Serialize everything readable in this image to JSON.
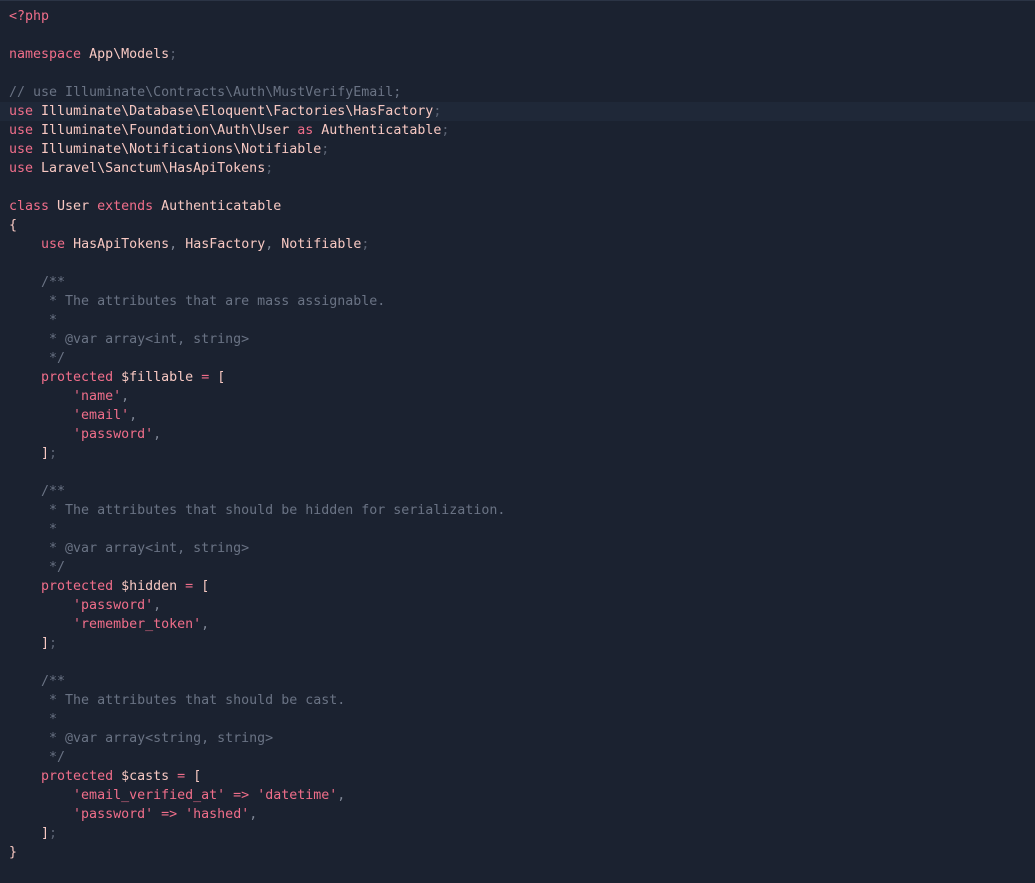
{
  "editor": {
    "language": "php",
    "current_line": 6,
    "colors": {
      "background": "#1b2230",
      "keyword": "#f06e8a",
      "identifier": "#f7c8c2",
      "comment": "#6a7384",
      "string": "#f06e8a",
      "punctuation": "#7f8796"
    }
  },
  "lines": [
    [
      [
        "tag",
        "<?php"
      ]
    ],
    [],
    [
      [
        "kw",
        "namespace"
      ],
      [
        "space",
        " "
      ],
      [
        "ns",
        "App\\Models"
      ],
      [
        "semi",
        ";"
      ]
    ],
    [],
    [
      [
        "comment",
        "// use Illuminate\\Contracts\\Auth\\MustVerifyEmail;"
      ]
    ],
    [
      [
        "kw",
        "use"
      ],
      [
        "space",
        " "
      ],
      [
        "ns",
        "Illuminate\\Database\\Eloquent\\Factories\\HasFactory"
      ],
      [
        "semi",
        ";"
      ]
    ],
    [
      [
        "kw",
        "use"
      ],
      [
        "space",
        " "
      ],
      [
        "ns",
        "Illuminate\\Foundation\\Auth\\User"
      ],
      [
        "space",
        " "
      ],
      [
        "kw",
        "as"
      ],
      [
        "space",
        " "
      ],
      [
        "id",
        "Authenticatable"
      ],
      [
        "semi",
        ";"
      ]
    ],
    [
      [
        "kw",
        "use"
      ],
      [
        "space",
        " "
      ],
      [
        "ns",
        "Illuminate\\Notifications\\Notifiable"
      ],
      [
        "semi",
        ";"
      ]
    ],
    [
      [
        "kw",
        "use"
      ],
      [
        "space",
        " "
      ],
      [
        "ns",
        "Laravel\\Sanctum\\HasApiTokens"
      ],
      [
        "semi",
        ";"
      ]
    ],
    [],
    [
      [
        "kw",
        "class"
      ],
      [
        "space",
        " "
      ],
      [
        "id",
        "User"
      ],
      [
        "space",
        " "
      ],
      [
        "kw",
        "extends"
      ],
      [
        "space",
        " "
      ],
      [
        "id",
        "Authenticatable"
      ]
    ],
    [
      [
        "brace",
        "{"
      ]
    ],
    [
      [
        "space",
        "    "
      ],
      [
        "kw",
        "use"
      ],
      [
        "space",
        " "
      ],
      [
        "id",
        "HasApiTokens"
      ],
      [
        "punc",
        ","
      ],
      [
        "space",
        " "
      ],
      [
        "id",
        "HasFactory"
      ],
      [
        "punc",
        ","
      ],
      [
        "space",
        " "
      ],
      [
        "id",
        "Notifiable"
      ],
      [
        "semi",
        ";"
      ]
    ],
    [],
    [
      [
        "space",
        "    "
      ],
      [
        "comment",
        "/**"
      ]
    ],
    [
      [
        "space",
        "    "
      ],
      [
        "comment",
        " * The attributes that are mass assignable."
      ]
    ],
    [
      [
        "space",
        "    "
      ],
      [
        "comment",
        " *"
      ]
    ],
    [
      [
        "space",
        "    "
      ],
      [
        "comment",
        " * @var array<int, string>"
      ]
    ],
    [
      [
        "space",
        "    "
      ],
      [
        "comment",
        " */"
      ]
    ],
    [
      [
        "space",
        "    "
      ],
      [
        "kw",
        "protected"
      ],
      [
        "space",
        " "
      ],
      [
        "var",
        "$fillable"
      ],
      [
        "space",
        " "
      ],
      [
        "op",
        "="
      ],
      [
        "space",
        " "
      ],
      [
        "brace",
        "["
      ]
    ],
    [
      [
        "space",
        "        "
      ],
      [
        "str",
        "'name'"
      ],
      [
        "punc",
        ","
      ]
    ],
    [
      [
        "space",
        "        "
      ],
      [
        "str",
        "'email'"
      ],
      [
        "punc",
        ","
      ]
    ],
    [
      [
        "space",
        "        "
      ],
      [
        "str",
        "'password'"
      ],
      [
        "punc",
        ","
      ]
    ],
    [
      [
        "space",
        "    "
      ],
      [
        "brace",
        "]"
      ],
      [
        "semi",
        ";"
      ]
    ],
    [],
    [
      [
        "space",
        "    "
      ],
      [
        "comment",
        "/**"
      ]
    ],
    [
      [
        "space",
        "    "
      ],
      [
        "comment",
        " * The attributes that should be hidden for serialization."
      ]
    ],
    [
      [
        "space",
        "    "
      ],
      [
        "comment",
        " *"
      ]
    ],
    [
      [
        "space",
        "    "
      ],
      [
        "comment",
        " * @var array<int, string>"
      ]
    ],
    [
      [
        "space",
        "    "
      ],
      [
        "comment",
        " */"
      ]
    ],
    [
      [
        "space",
        "    "
      ],
      [
        "kw",
        "protected"
      ],
      [
        "space",
        " "
      ],
      [
        "var",
        "$hidden"
      ],
      [
        "space",
        " "
      ],
      [
        "op",
        "="
      ],
      [
        "space",
        " "
      ],
      [
        "brace",
        "["
      ]
    ],
    [
      [
        "space",
        "        "
      ],
      [
        "str",
        "'password'"
      ],
      [
        "punc",
        ","
      ]
    ],
    [
      [
        "space",
        "        "
      ],
      [
        "str",
        "'remember_token'"
      ],
      [
        "punc",
        ","
      ]
    ],
    [
      [
        "space",
        "    "
      ],
      [
        "brace",
        "]"
      ],
      [
        "semi",
        ";"
      ]
    ],
    [],
    [
      [
        "space",
        "    "
      ],
      [
        "comment",
        "/**"
      ]
    ],
    [
      [
        "space",
        "    "
      ],
      [
        "comment",
        " * The attributes that should be cast."
      ]
    ],
    [
      [
        "space",
        "    "
      ],
      [
        "comment",
        " *"
      ]
    ],
    [
      [
        "space",
        "    "
      ],
      [
        "comment",
        " * @var array<string, string>"
      ]
    ],
    [
      [
        "space",
        "    "
      ],
      [
        "comment",
        " */"
      ]
    ],
    [
      [
        "space",
        "    "
      ],
      [
        "kw",
        "protected"
      ],
      [
        "space",
        " "
      ],
      [
        "var",
        "$casts"
      ],
      [
        "space",
        " "
      ],
      [
        "op",
        "="
      ],
      [
        "space",
        " "
      ],
      [
        "brace",
        "["
      ]
    ],
    [
      [
        "space",
        "        "
      ],
      [
        "str",
        "'email_verified_at'"
      ],
      [
        "space",
        " "
      ],
      [
        "op",
        "=>"
      ],
      [
        "space",
        " "
      ],
      [
        "str",
        "'datetime'"
      ],
      [
        "punc",
        ","
      ]
    ],
    [
      [
        "space",
        "        "
      ],
      [
        "str",
        "'password'"
      ],
      [
        "space",
        " "
      ],
      [
        "op",
        "=>"
      ],
      [
        "space",
        " "
      ],
      [
        "str",
        "'hashed'"
      ],
      [
        "punc",
        ","
      ]
    ],
    [
      [
        "space",
        "    "
      ],
      [
        "brace",
        "]"
      ],
      [
        "semi",
        ";"
      ]
    ],
    [
      [
        "brace",
        "}"
      ]
    ]
  ]
}
